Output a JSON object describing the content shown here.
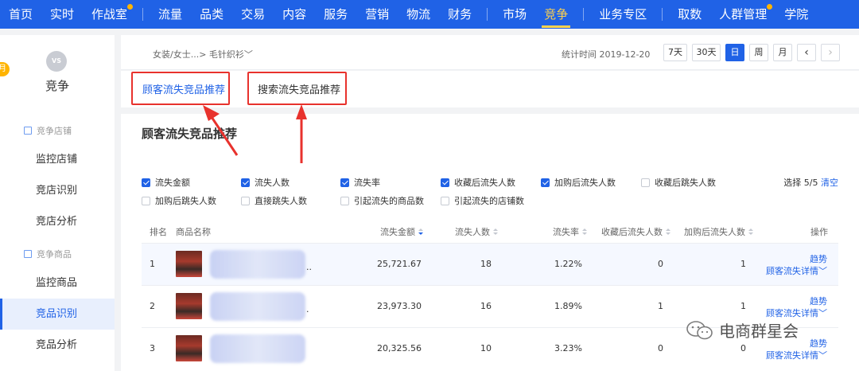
{
  "nav": {
    "items": [
      {
        "label": "首页"
      },
      {
        "label": "实时"
      },
      {
        "label": "作战室",
        "dot": true
      },
      {
        "sep": true
      },
      {
        "label": "流量"
      },
      {
        "label": "品类"
      },
      {
        "label": "交易"
      },
      {
        "label": "内容"
      },
      {
        "label": "服务"
      },
      {
        "label": "营销"
      },
      {
        "label": "物流"
      },
      {
        "label": "财务"
      },
      {
        "sep": true
      },
      {
        "label": "市场"
      },
      {
        "label": "竞争",
        "active": true
      },
      {
        "sep": true
      },
      {
        "label": "业务专区"
      },
      {
        "sep": true
      },
      {
        "label": "取数"
      },
      {
        "label": "人群管理",
        "dot": true
      },
      {
        "label": "学院"
      }
    ]
  },
  "sidebar": {
    "badge": "月",
    "icon_text": "VS",
    "title": "竞争",
    "group_store": "竞争店铺",
    "group_goods": "竞争商品",
    "items": [
      {
        "label": "监控店铺"
      },
      {
        "label": "竞店识别"
      },
      {
        "label": "竞店分析"
      },
      {
        "label": "监控商品"
      },
      {
        "label": "竞品识别",
        "active": true
      },
      {
        "label": "竞品分析"
      }
    ]
  },
  "header": {
    "breadcrumb": "女装/女士...> 毛针织衫﹀",
    "stat_time": "统计时间 2019-12-20",
    "date_buttons": [
      "7天",
      "30天",
      "日",
      "周",
      "月"
    ],
    "active_date": "日",
    "prev": "‹",
    "next": "›"
  },
  "tabs": {
    "customer_loss": "顾客流失竞品推荐",
    "search_loss": "搜索流失竞品推荐"
  },
  "panel": {
    "title": "顾客流失竞品推荐",
    "checkboxes_row1": [
      {
        "label": "流失金额",
        "checked": true
      },
      {
        "label": "流失人数",
        "checked": true
      },
      {
        "label": "流失率",
        "checked": true
      },
      {
        "label": "收藏后流失人数",
        "checked": true
      },
      {
        "label": "加购后流失人数",
        "checked": true
      },
      {
        "label": "收藏后跳失人数",
        "checked": false
      }
    ],
    "checkboxes_row2": [
      {
        "label": "加购后跳失人数",
        "checked": false
      },
      {
        "label": "直接跳失人数",
        "checked": false
      },
      {
        "label": "引起流失的商品数",
        "checked": false
      },
      {
        "label": "引起流失的店铺数",
        "checked": false
      }
    ],
    "select_count": "选择 5/5",
    "clear": "清空",
    "columns": {
      "rank": "排名",
      "name": "商品名称",
      "amount": "流失金额",
      "people": "流失人数",
      "rate": "流失率",
      "fav_loss": "收藏后流失人数",
      "cart_loss": "加购后流失人数",
      "ops": "操作"
    },
    "rows": [
      {
        "rank": "1",
        "name_tail": "..",
        "amount": "25,721.67",
        "people": "18",
        "rate": "1.22%",
        "fav_loss": "0",
        "cart_loss": "1",
        "trend": "趋势",
        "detail": "顾客流失详情﹀"
      },
      {
        "rank": "2",
        "name_tail": ".",
        "amount": "23,973.30",
        "people": "16",
        "rate": "1.89%",
        "fav_loss": "1",
        "cart_loss": "1",
        "trend": "趋势",
        "detail": "顾客流失详情﹀"
      },
      {
        "rank": "3",
        "name_tail": "",
        "amount": "20,325.56",
        "people": "10",
        "rate": "3.23%",
        "fav_loss": "0",
        "cart_loss": "0",
        "trend": "趋势",
        "detail": "顾客流失详情﹀"
      }
    ]
  },
  "watermark": "电商群星会",
  "colors": {
    "brand": "#2062e6",
    "highlight": "#e8322d",
    "active_nav": "#ffd34d"
  }
}
